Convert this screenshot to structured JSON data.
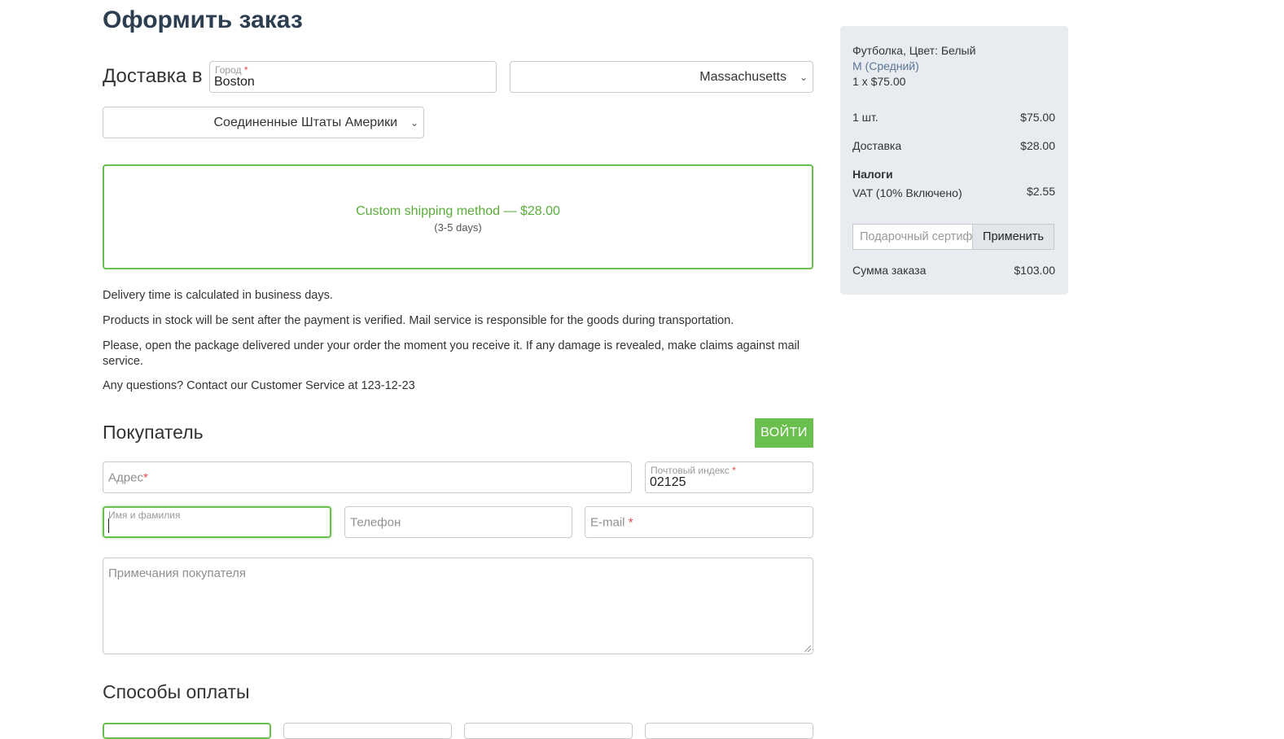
{
  "checkout": {
    "title": "Оформить заказ",
    "delivery_label": "Доставка в",
    "city": {
      "label": "Город",
      "required": "*",
      "value": "Boston"
    },
    "state": {
      "value": "Massachusetts"
    },
    "country": {
      "value": "Соединенные Штаты Америки"
    },
    "shipping": {
      "name": "Custom shipping method — $28.00",
      "days": "(3-5 days)"
    },
    "info": [
      "Delivery time is calculated in business days.",
      "Products in stock will be sent after the payment is verified. Mail service is responsible for the goods during transportation.",
      "Please, open the package delivered under your order the moment you receive it. If any damage is revealed, make claims against mail service.",
      "Any questions? Contact our Customer Service at 123-12-23"
    ]
  },
  "buyer": {
    "title": "Покупатель",
    "login_label": "ВОЙТИ",
    "address": {
      "placeholder": "Адрес",
      "required": "*"
    },
    "zip": {
      "label": "Почтовый индекс",
      "required": "*",
      "value": "02125"
    },
    "name": {
      "label": "Имя и фамилия",
      "value": ""
    },
    "phone": {
      "placeholder": "Телефон"
    },
    "email": {
      "placeholder": "E-mail",
      "required": "*"
    },
    "notes": {
      "placeholder": "Примечания покупателя"
    }
  },
  "payment": {
    "title": "Способы оплаты"
  },
  "summary": {
    "product": "Футболка, Цвет: Белый",
    "variant": "M (Средний)",
    "qty_price": "1 x $75.00",
    "items_label": "1 шт.",
    "items_value": "$75.00",
    "delivery_label": "Доставка",
    "delivery_value": "$28.00",
    "taxes_label": "Налоги",
    "vat_label": "VAT (10% Включено)",
    "vat_value": "$2.55",
    "gift_placeholder": "Подарочный сертификат",
    "apply_label": "Применить",
    "total_label": "Сумма заказа",
    "total_value": "$103.00"
  },
  "colors": {
    "accent": "#6bbf4e",
    "summary_bg": "#e8ecf0",
    "required": "#e04848"
  }
}
